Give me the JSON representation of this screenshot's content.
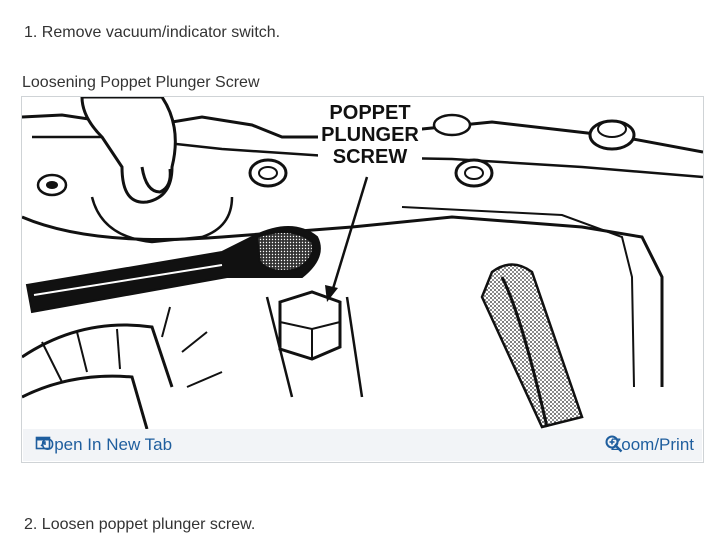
{
  "steps": {
    "step1": "1. Remove vacuum/indicator switch.",
    "step2": "2. Loosen poppet plunger screw."
  },
  "figure": {
    "caption": "Loosening Poppet Plunger Screw",
    "callout": [
      "POPPET",
      "PLUNGER",
      "SCREW"
    ],
    "open_label": "Open In New Tab",
    "zoom_label": "Zoom/Print"
  },
  "colors": {
    "link": "#1f5e9e",
    "footer_bg": "#f2f4f7",
    "border": "#cfd3d6"
  },
  "icons": {
    "open": "open-in-new-tab-icon",
    "zoom": "magnifier-plus-icon"
  }
}
